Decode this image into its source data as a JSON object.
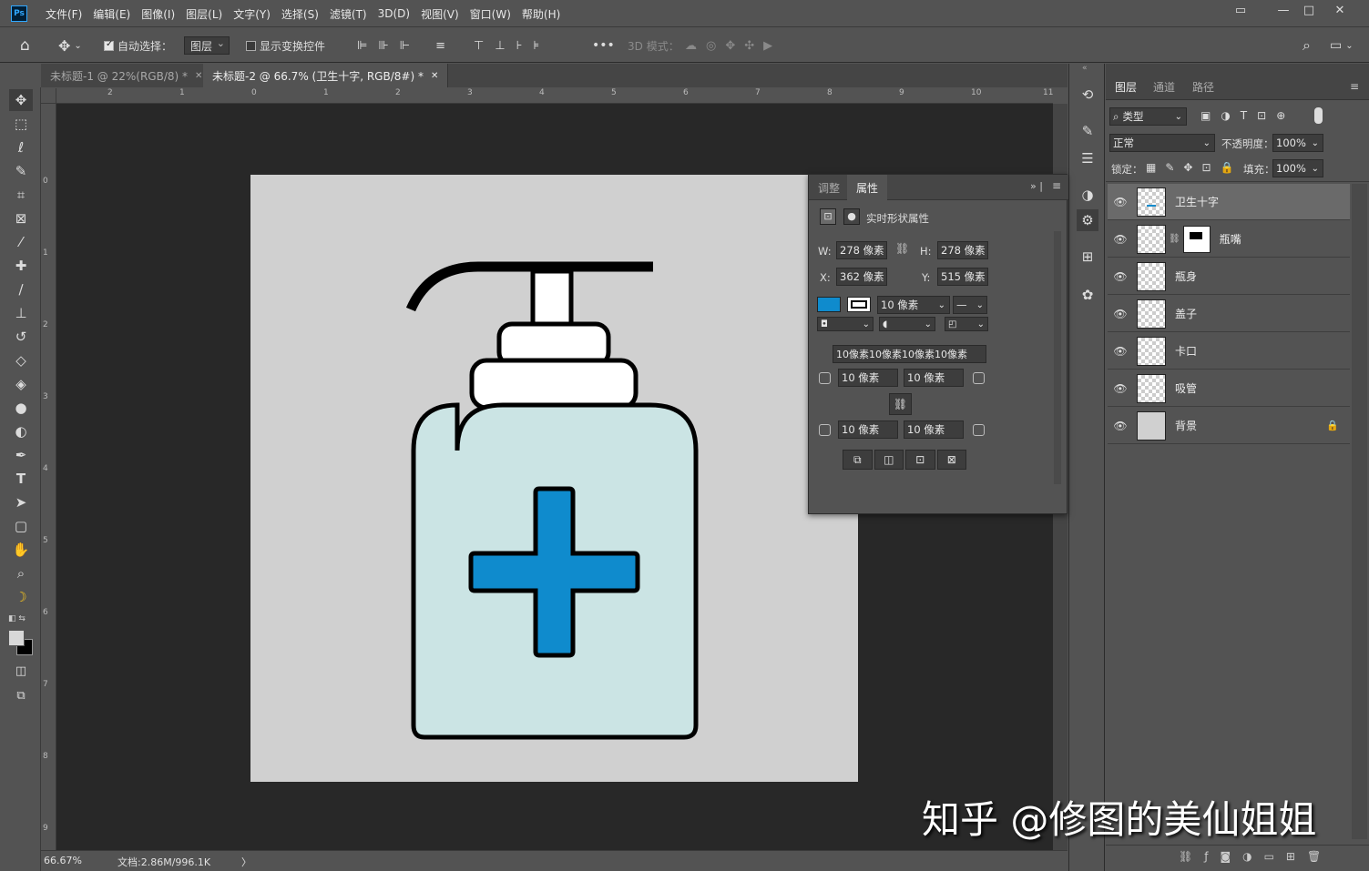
{
  "app": {
    "logo": "Ps"
  },
  "menu": [
    "文件(F)",
    "编辑(E)",
    "图像(I)",
    "图层(L)",
    "文字(Y)",
    "选择(S)",
    "滤镜(T)",
    "3D(D)",
    "视图(V)",
    "窗口(W)",
    "帮助(H)"
  ],
  "options": {
    "auto_select": "自动选择：",
    "auto_select_value": "图层",
    "show_transform": "显示变换控件",
    "mode_3d": "3D 模式："
  },
  "tabs": [
    {
      "label": "未标题-1 @ 22%(RGB/8) *",
      "active": false
    },
    {
      "label": "未标题-2 @ 66.7% (卫生十字, RGB/8#) *",
      "active": true
    }
  ],
  "ruler_top": [
    "2",
    "1",
    "0",
    "1",
    "2",
    "3",
    "4",
    "5",
    "6",
    "7",
    "8",
    "9",
    "10",
    "11"
  ],
  "ruler_left": [
    "0",
    "1",
    "2",
    "3",
    "4",
    "5",
    "6",
    "7",
    "8",
    "9"
  ],
  "status": {
    "zoom": "66.67%",
    "doc": "文档:2.86M/996.1K",
    "arrow": "〉"
  },
  "properties": {
    "tabs": [
      "调整",
      "属性"
    ],
    "title": "实时形状属性",
    "w_label": "W:",
    "w": "278 像素",
    "h_label": "H:",
    "h": "278 像素",
    "x_label": "X:",
    "x": "362 像素",
    "y_label": "Y:",
    "y": "515 像素",
    "stroke_width": "10 像素",
    "corners_all": "10像素10像素10像素10像素",
    "corner_tl": "10 像素",
    "corner_tr": "10 像素",
    "corner_bl": "10 像素",
    "corner_br": "10 像素",
    "fill_color": "#0f8bcd"
  },
  "layers_panel": {
    "tabs": [
      "图层",
      "通道",
      "路径"
    ],
    "filter": "类型",
    "blend": "正常",
    "opacity_label": "不透明度：",
    "opacity": "100%",
    "lock_label": "锁定：",
    "fill_label": "填充：",
    "fill": "100%",
    "layers": [
      {
        "name": "卫生十字",
        "selected": true
      },
      {
        "name": "瓶嘴",
        "selected": false
      },
      {
        "name": "瓶身",
        "selected": false
      },
      {
        "name": "盖子",
        "selected": false
      },
      {
        "name": "卡口",
        "selected": false
      },
      {
        "name": "吸管",
        "selected": false
      },
      {
        "name": "背景",
        "selected": false
      }
    ]
  },
  "watermark": "知乎 @修图的美仙姐姐",
  "artwork": {
    "bottle_fill": "#cbe4e4",
    "cross_fill": "#0f8bcd",
    "outline": "#000000",
    "background": "#d0d0d0"
  }
}
